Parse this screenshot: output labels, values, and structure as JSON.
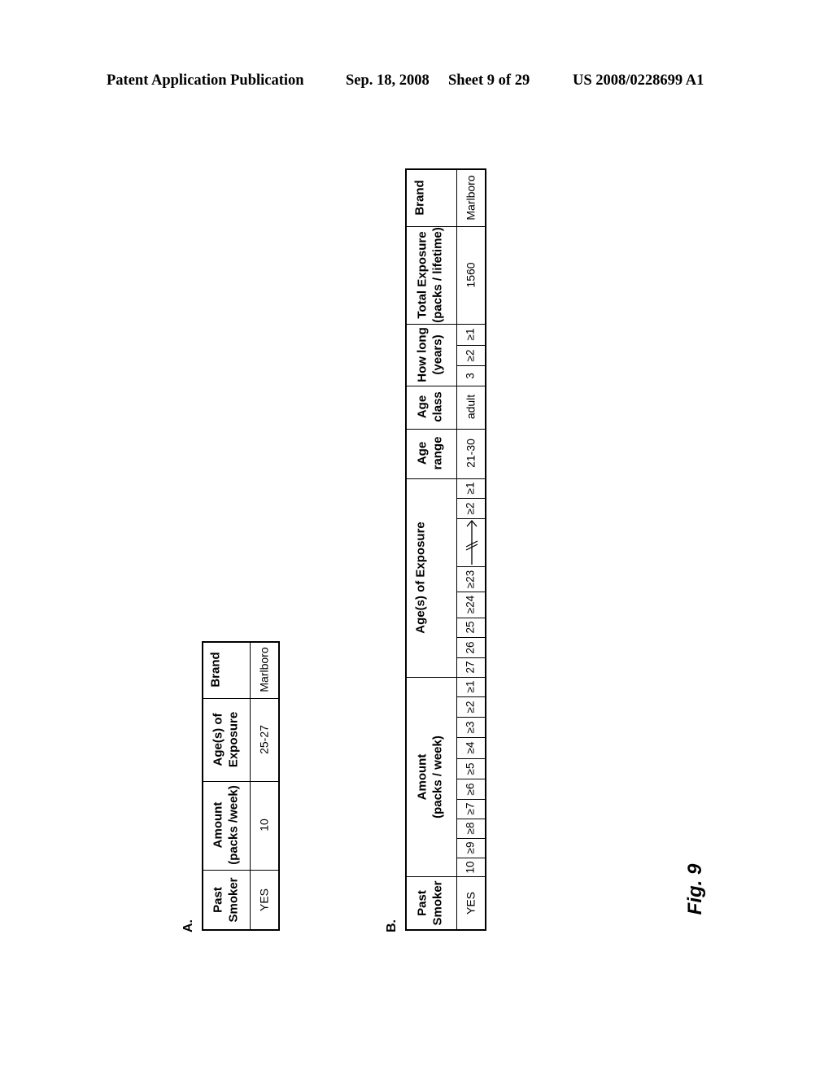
{
  "header": {
    "left": "Patent Application Publication",
    "date": "Sep. 18, 2008",
    "sheet": "Sheet 9 of 29",
    "number": "US 2008/0228699 A1"
  },
  "figure_label": "Fig. 9",
  "table_a": {
    "label": "A.",
    "columns": [
      {
        "line1": "Past",
        "line2": "Smoker"
      },
      {
        "line1": "Amount",
        "line2": "(packs /week)"
      },
      {
        "line1": "Age(s) of",
        "line2": "Exposure"
      },
      {
        "line1": "Brand",
        "line2": ""
      }
    ],
    "row": [
      "YES",
      "10",
      "25-27",
      "Marlboro"
    ]
  },
  "table_b": {
    "label": "B.",
    "columns": [
      {
        "line1": "Past",
        "line2": "Smoker"
      },
      {
        "line1": "Amount",
        "line2": "(packs / week)"
      },
      {
        "line1": "Age(s) of Exposure",
        "line2": ""
      },
      {
        "line1": "Age",
        "line2": "range"
      },
      {
        "line1": "Age",
        "line2": "class"
      },
      {
        "line1": "How long",
        "line2": "(years)"
      },
      {
        "line1": "Total Exposure",
        "line2": "(packs / lifetime)"
      },
      {
        "line1": "Brand",
        "line2": ""
      }
    ],
    "past_smoker": "YES",
    "amount_cells": [
      "10",
      "≥9",
      "≥8",
      "≥7",
      "≥6",
      "≥5",
      "≥4",
      "≥3",
      "≥2",
      "≥1"
    ],
    "age_cells": [
      "27",
      "26",
      "25",
      "≥24",
      "≥23",
      "arrow",
      "≥2",
      "≥1"
    ],
    "age_range": "21-30",
    "age_class": "adult",
    "how_long_cells": [
      "3",
      "≥2",
      "≥1"
    ],
    "total_exposure": "1560",
    "brand": "Marlboro"
  }
}
